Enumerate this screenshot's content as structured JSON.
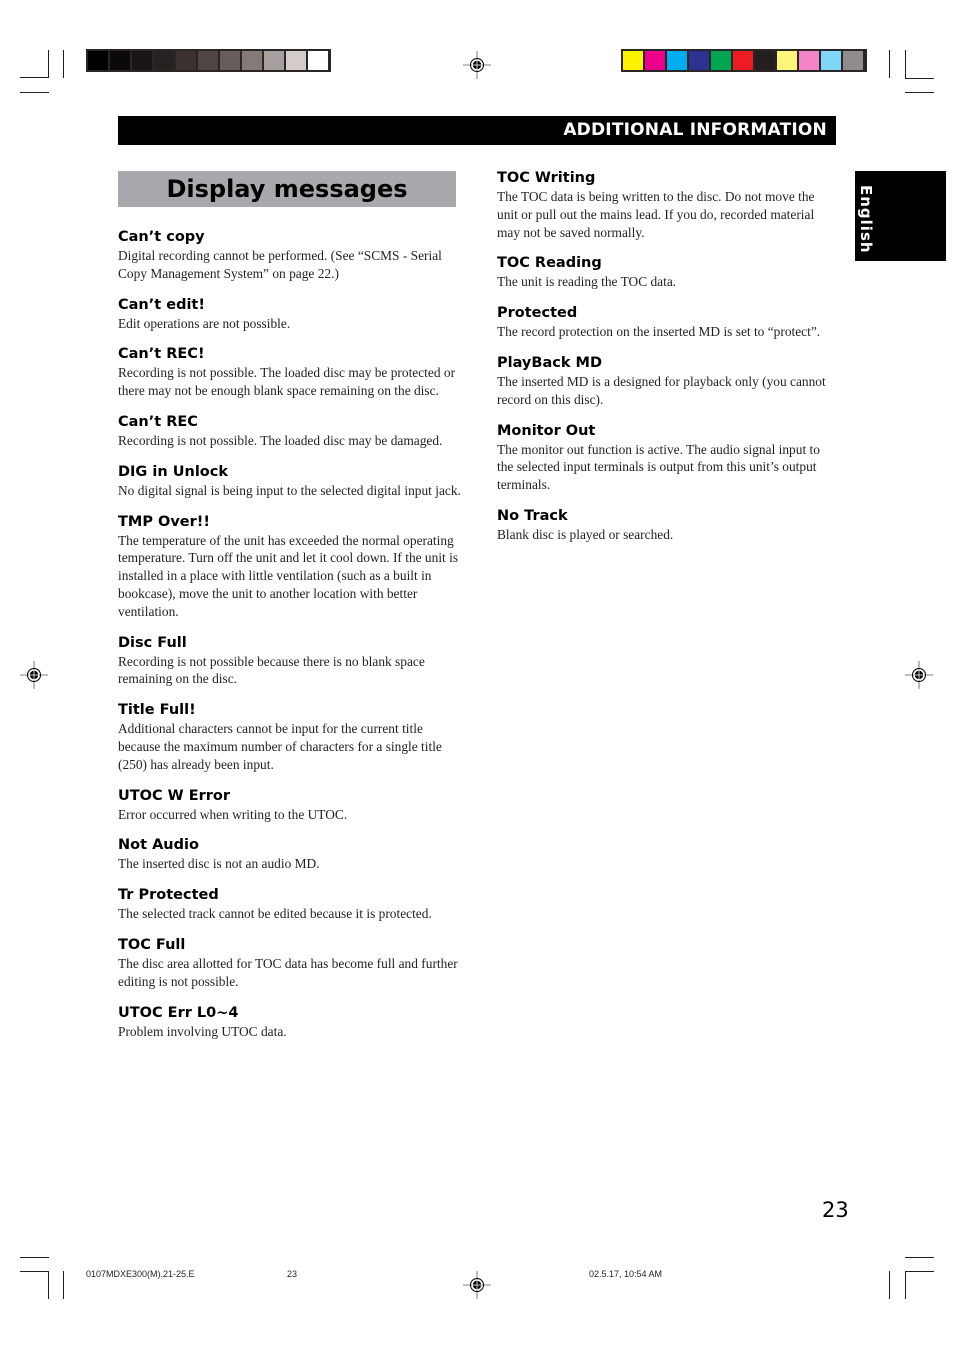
{
  "header": {
    "section_title": "ADDITIONAL INFORMATION",
    "page_title": "Display messages",
    "language_tab": "English"
  },
  "registration": {
    "grayscale_colors": [
      "#000000",
      "#0c0a09",
      "#181514",
      "#272220",
      "#3a3130",
      "#4f4644",
      "#675d5b",
      "#857a78",
      "#a79f9d",
      "#d3cccb",
      "#ffffff"
    ],
    "color_swatches": [
      "#fff200",
      "#ec008c",
      "#00aeef",
      "#2e3192",
      "#00a651",
      "#ed1c24",
      "#231f20",
      "#fff77d",
      "#f384c6",
      "#7fd6f7",
      "#8e8c8c"
    ]
  },
  "left_column": [
    {
      "title": "Can’t copy",
      "text": "Digital recording cannot be performed. (See “SCMS - Serial Copy Management System” on page 22.)"
    },
    {
      "title": "Can’t edit!",
      "text": "Edit operations are not possible."
    },
    {
      "title": "Can’t REC!",
      "text": "Recording is not possible. The loaded disc may be protected or there may not be enough blank space remaining on the disc."
    },
    {
      "title": "Can’t REC",
      "text": "Recording is not possible. The loaded disc may be damaged."
    },
    {
      "title": "DIG in Unlock",
      "text": "No digital signal is being input to the selected digital input jack."
    },
    {
      "title": "TMP Over!!",
      "text": "The temperature of the unit has exceeded the normal operating temperature. Turn off the unit and let it cool down. If the unit is installed in a place with little ventilation (such as a built in bookcase), move the unit to another location with better ventilation."
    },
    {
      "title": "Disc Full",
      "text": "Recording is not possible because there is no blank space remaining on the disc."
    },
    {
      "title": "Title Full!",
      "text": "Additional characters cannot be input for the current title because the maximum number of characters for a single title (250) has already been input."
    },
    {
      "title": "UTOC W Error",
      "text": "Error occurred when writing to the UTOC."
    },
    {
      "title": "Not Audio",
      "text": "The inserted disc is not an audio MD."
    },
    {
      "title": "Tr Protected",
      "text": "The selected track cannot be edited because it is protected."
    },
    {
      "title": "TOC Full",
      "text": "The disc area allotted for TOC data has become full and further editing is not possible."
    },
    {
      "title": "UTOC Err L0~4",
      "text": "Problem involving UTOC data."
    }
  ],
  "right_column": [
    {
      "title": "TOC Writing",
      "text": "The TOC data is being written to the disc. Do not move the unit or pull out the mains lead. If you do, recorded material may not be saved normally."
    },
    {
      "title": "TOC Reading",
      "text": "The unit is reading the TOC data."
    },
    {
      "title": "Protected",
      "text": "The record protection on the inserted MD is set to “protect”."
    },
    {
      "title": "PlayBack MD",
      "text": "The inserted MD is a designed for playback only (you cannot record on this disc)."
    },
    {
      "title": "Monitor Out",
      "text": "The monitor out function is active. The audio signal input to the selected input terminals is output from this unit’s output terminals."
    },
    {
      "title": "No Track",
      "text": "Blank disc is played or searched."
    }
  ],
  "footer": {
    "page_number": "23",
    "file_name": "0107MDXE300(M).21-25.E",
    "file_page": "23",
    "timestamp": "02.5.17, 10:54 AM"
  }
}
